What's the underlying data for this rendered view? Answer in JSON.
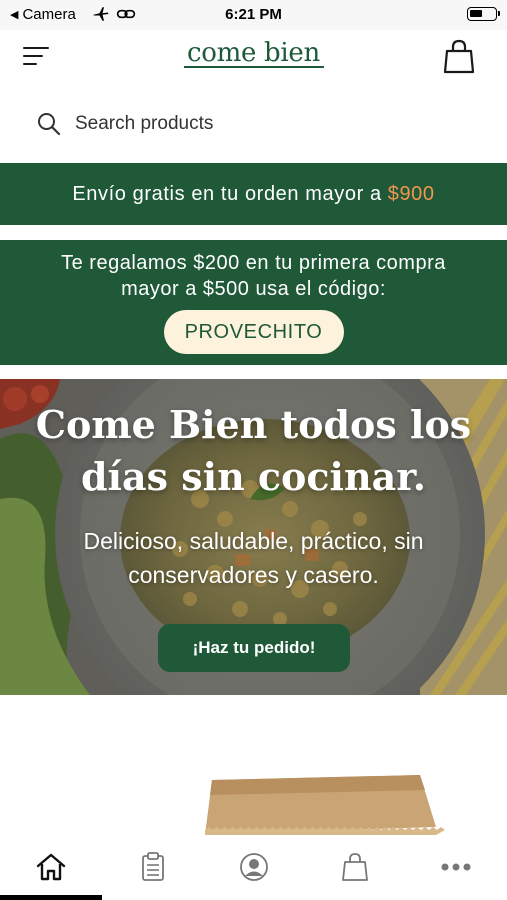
{
  "status_bar": {
    "back_label": "Camera",
    "time": "6:21 PM"
  },
  "header": {
    "logo_text": "come bien",
    "menu_icon": "hamburger-menu-icon",
    "cart_icon": "shopping-bag-icon"
  },
  "search": {
    "placeholder": "Search products",
    "icon": "search-icon"
  },
  "promo_shipping": {
    "text": "Envío gratis en tu orden mayor a",
    "amount": "$900",
    "amount_color": "#f29550"
  },
  "promo_coupon": {
    "line1": "Te regalamos $200 en tu primera compra",
    "line2": "mayor a $500 usa el código:",
    "code": "PROVECHITO"
  },
  "hero": {
    "title_line1": "Come Bien todos los",
    "title_line2": "días sin cocinar.",
    "subtitle_line1": "Delicioso, saludable, práctico, sin",
    "subtitle_line2": "conservadores y casero.",
    "cta_label": "¡Haz tu pedido!"
  },
  "tab_bar": {
    "items": [
      {
        "icon": "home-icon",
        "active": true
      },
      {
        "icon": "clipboard-icon",
        "active": false
      },
      {
        "icon": "account-icon",
        "active": false
      },
      {
        "icon": "shopping-bag-icon",
        "active": false
      },
      {
        "icon": "more-icon",
        "active": false
      }
    ]
  },
  "colors": {
    "brand_green": "#1f5937",
    "accent_orange": "#f29550",
    "pill_cream": "#fdf3dc"
  }
}
